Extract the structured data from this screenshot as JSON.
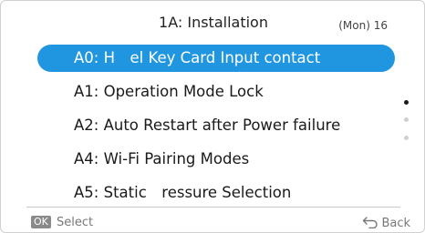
{
  "header": {
    "title": "1A: Installation",
    "time": "(Mon) 16"
  },
  "menu": {
    "items": [
      {
        "label": "A0: H el Key Card Input contact"
      },
      {
        "label": "A1: Operation Mode Lock"
      },
      {
        "label": "A2: Auto Restart after Power failure"
      },
      {
        "label": "A4: Wi-Fi Pairing Modes"
      },
      {
        "label": "A5: Static ressure Selection"
      }
    ],
    "selected_index": 0
  },
  "scroll": {
    "pages": 3,
    "current_page": 1
  },
  "footer": {
    "ok_badge": "OK",
    "ok_label": "Select",
    "back_label": "Back"
  },
  "colors": {
    "accent": "#2196e0"
  },
  "icons": {
    "ok": "ok-button-badge",
    "back": "back-arrow-icon"
  }
}
